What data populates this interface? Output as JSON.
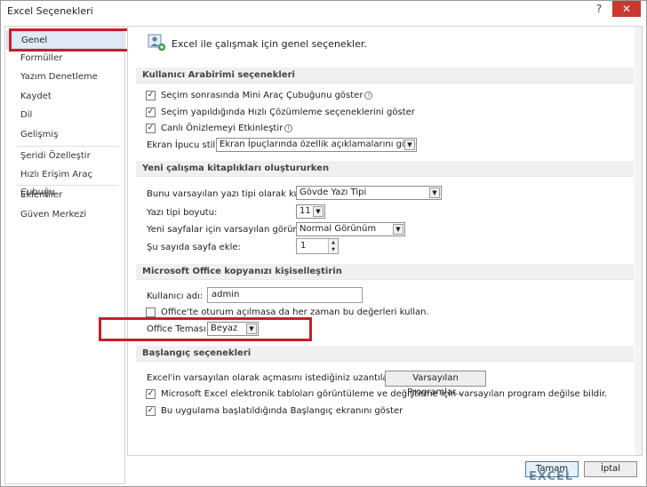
{
  "window": {
    "title": "Excel Seçenekleri",
    "help_glyph": "?",
    "close_glyph": "✕"
  },
  "sidebar": {
    "items": [
      {
        "label": "Genel"
      },
      {
        "label": "Formüller"
      },
      {
        "label": "Yazım Denetleme"
      },
      {
        "label": "Kaydet"
      },
      {
        "label": "Dil"
      },
      {
        "label": "Gelişmiş"
      },
      {
        "label": "Şeridi Özelleştir"
      },
      {
        "label": "Hızlı Erişim Araç Çubuğu"
      },
      {
        "label": "Eklentiler"
      },
      {
        "label": "Güven Merkezi"
      }
    ]
  },
  "main": {
    "header": "Excel ile çalışmak için genel seçenekler.",
    "ui_section": {
      "title": "Kullanıcı Arabirimi seçenekleri",
      "mini_toolbar": "Seçim sonrasında Mini Araç Çubuğunu göster",
      "quick_analysis": "Seçim yapıldığında Hızlı Çözümleme seçeneklerini göster",
      "live_preview": "Canlı Önizlemeyi Etkinleştir",
      "screentip_label": "Ekran İpucu stili:",
      "screentip_value": "Ekran İpuçlarında özellik açıklamalarını göster"
    },
    "workbook_section": {
      "title": "Yeni çalışma kitaplıkları oluştururken",
      "font_label": "Bunu varsayılan yazı tipi olarak kullan:",
      "font_value": "Gövde Yazı Tipi",
      "size_label": "Yazı tipi boyutu:",
      "size_value": "11",
      "view_label": "Yeni sayfalar için varsayılan görünüm:",
      "view_value": "Normal Görünüm",
      "sheets_label": "Şu sayıda sayfa ekle:",
      "sheets_value": "1"
    },
    "personalize_section": {
      "title": "Microsoft Office kopyanızı kişiselleştirin",
      "user_label": "Kullanıcı adı:",
      "user_value": "admin",
      "always_use": "Office'te oturum açılmasa da her zaman bu değerleri kullan.",
      "theme_label": "Office Teması:",
      "theme_value": "Beyaz"
    },
    "startup_section": {
      "title": "Başlangıç seçenekleri",
      "ext_label": "Excel'in varsayılan olarak açmasını istediğiniz uzantıları seçin:",
      "default_programs_button": "Varsayılan Programlar...",
      "not_default": "Microsoft Excel elektronik tabloları görüntüleme ve değiştirme için varsayılan program değilse bildir.",
      "show_start": "Bu uygulama başlatıldığında Başlangıç ekranını göster"
    }
  },
  "footer": {
    "ok": "Tamam",
    "cancel": "İptal"
  },
  "watermark": "EXCEL"
}
